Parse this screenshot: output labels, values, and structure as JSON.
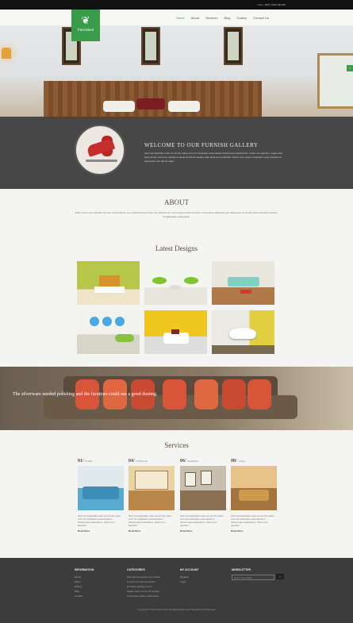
{
  "topbar": {
    "text": "CALL: (800) 7600-300 900"
  },
  "logo": {
    "name": "Furnished",
    "icon": "leaf-icon"
  },
  "nav": {
    "items": [
      "Home",
      "About",
      "Services",
      "Blog",
      "Gallery",
      "Contact Us"
    ],
    "active": 0
  },
  "welcome": {
    "title": "WELCOME TO OUR FURNISH GALLERY",
    "body": "Sed ut perspiciatis unde omnis iste natus error sit voluptatem accusantium doloremque laudantium, totam rem aperiam, eaque ipsa quae ab illo inventore veritatis et quasi architecto beatae vitae dicta sunt explicabo. Nemo enim ipsam voluptatem quia voluptas sit aspernatur aut odit aut fugit."
  },
  "about": {
    "title": "ABOUT",
    "body": "Etiam risus nunc pulvinar nisi quis ornare Donec sem vehicula lorem dolor nec ultrices nisi. Lorem ipsum dolor sit amet, consectetur adipiscing elit. Maecenas commodo tortor sed diam lobortis, fringilla ligula malesuada."
  },
  "latest": {
    "title": "Latest Designs"
  },
  "band": {
    "text": "The silverware needed polishing and the furniture could use a good dusting."
  },
  "services": {
    "title": "Services",
    "items": [
      {
        "num": "01/",
        "name": "Normal",
        "text": "Sed ut perspiciatis unde omnis iste natus error sit voluptatem accusantium doloremque laudantium, totam rem aperiam.",
        "more": "Read More"
      },
      {
        "num": "04/",
        "name": "Commercial",
        "text": "Sed ut perspiciatis unde omnis iste natus error sit voluptatem accusantium doloremque laudantium, totam rem aperiam.",
        "more": "Read More"
      },
      {
        "num": "06/",
        "name": "Residential",
        "text": "Sed ut perspiciatis unde omnis iste natus error sit voluptatem accusantium doloremque laudantium, totam rem aperiam.",
        "more": "Read More"
      },
      {
        "num": "08/",
        "name": "Luxury",
        "text": "Sed ut perspiciatis unde omnis iste natus error sit voluptatem accusantium doloremque laudantium, totam rem aperiam.",
        "more": "Read More"
      }
    ]
  },
  "footer": {
    "information": {
      "title": "INFORMATION",
      "items": [
        "Home",
        "About",
        "Gallery",
        "Blog",
        "Contact"
      ]
    },
    "categories": {
      "title": "CATEGORIES",
      "items": [
        "Nam libero tempore cum soluta",
        "Ut enim ad minima veniam",
        "Et harum quidem rerum",
        "Itaque earum rerum hic tenetur",
        "Temporibus autem quibusdam"
      ]
    },
    "account": {
      "title": "MY ACCOUNT",
      "items": [
        "Register",
        "Login"
      ]
    },
    "newsletter": {
      "title": "NEWSLETTER",
      "placeholder": "Enter Your Email",
      "button": "›"
    },
    "copyright": "Copyright © 2015 Furnished. All Rights Reserved. Template by W3layouts"
  },
  "colors": {
    "accent": "#3a9b4b",
    "dark": "#474747",
    "footer": "#3c3c3c"
  }
}
